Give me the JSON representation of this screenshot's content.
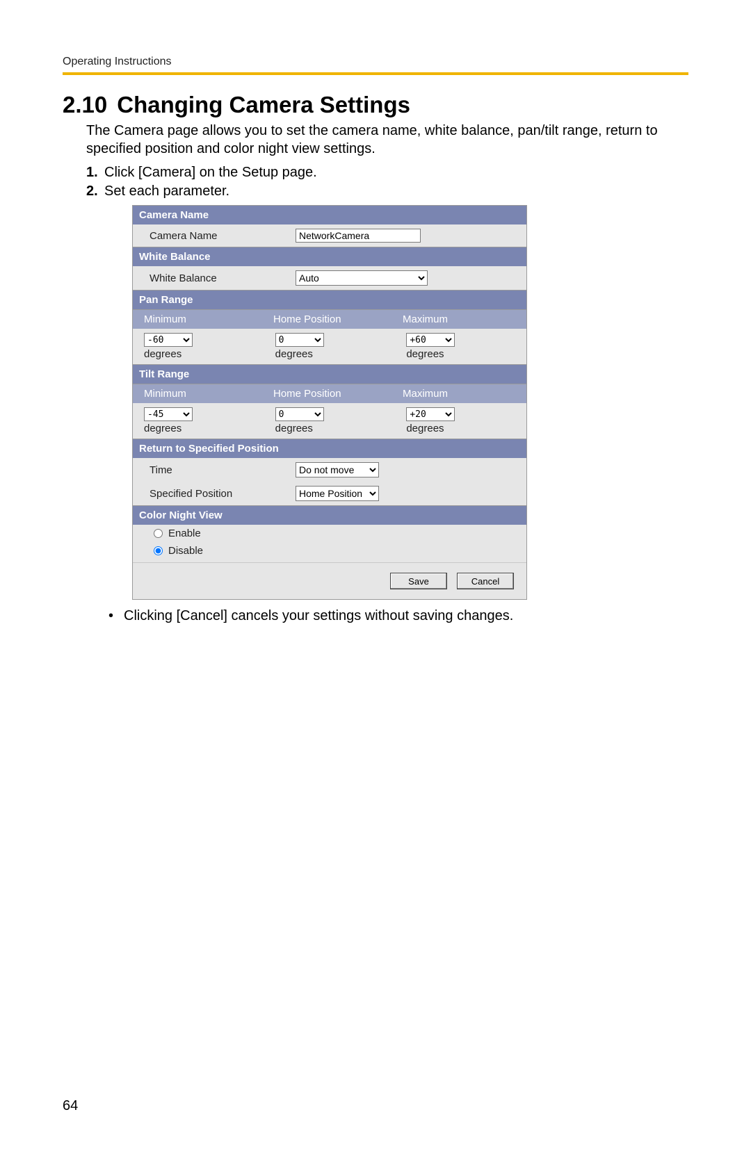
{
  "header": {
    "running": "Operating Instructions"
  },
  "section": {
    "number": "2.10",
    "title": "Changing Camera Settings"
  },
  "intro": "The Camera page allows you to set the camera name, white balance, pan/tilt range, return to specified position and color night view settings.",
  "steps": [
    {
      "num": "1.",
      "text": "Click [Camera] on the Setup page."
    },
    {
      "num": "2.",
      "text": "Set each parameter."
    }
  ],
  "panel": {
    "cameraName": {
      "header": "Camera Name",
      "label": "Camera Name",
      "value": "NetworkCamera"
    },
    "whiteBalance": {
      "header": "White Balance",
      "label": "White Balance",
      "selected": "Auto"
    },
    "panRange": {
      "header": "Pan Range",
      "cols": {
        "min": "Minimum",
        "home": "Home Position",
        "max": "Maximum"
      },
      "values": {
        "min": "-60",
        "home": "0",
        "max": "+60"
      },
      "unit": "degrees"
    },
    "tiltRange": {
      "header": "Tilt Range",
      "cols": {
        "min": "Minimum",
        "home": "Home Position",
        "max": "Maximum"
      },
      "values": {
        "min": "-45",
        "home": "0",
        "max": "+20"
      },
      "unit": "degrees"
    },
    "returnPos": {
      "header": "Return to Specified Position",
      "timeLabel": "Time",
      "timeValue": "Do not move",
      "specLabel": "Specified Position",
      "specValue": "Home Position"
    },
    "nightView": {
      "header": "Color Night View",
      "enable": "Enable",
      "disable": "Disable",
      "selected": "disable"
    },
    "buttons": {
      "save": "Save",
      "cancel": "Cancel"
    }
  },
  "note": "Clicking [Cancel] cancels your settings without saving changes.",
  "pageNumber": "64"
}
